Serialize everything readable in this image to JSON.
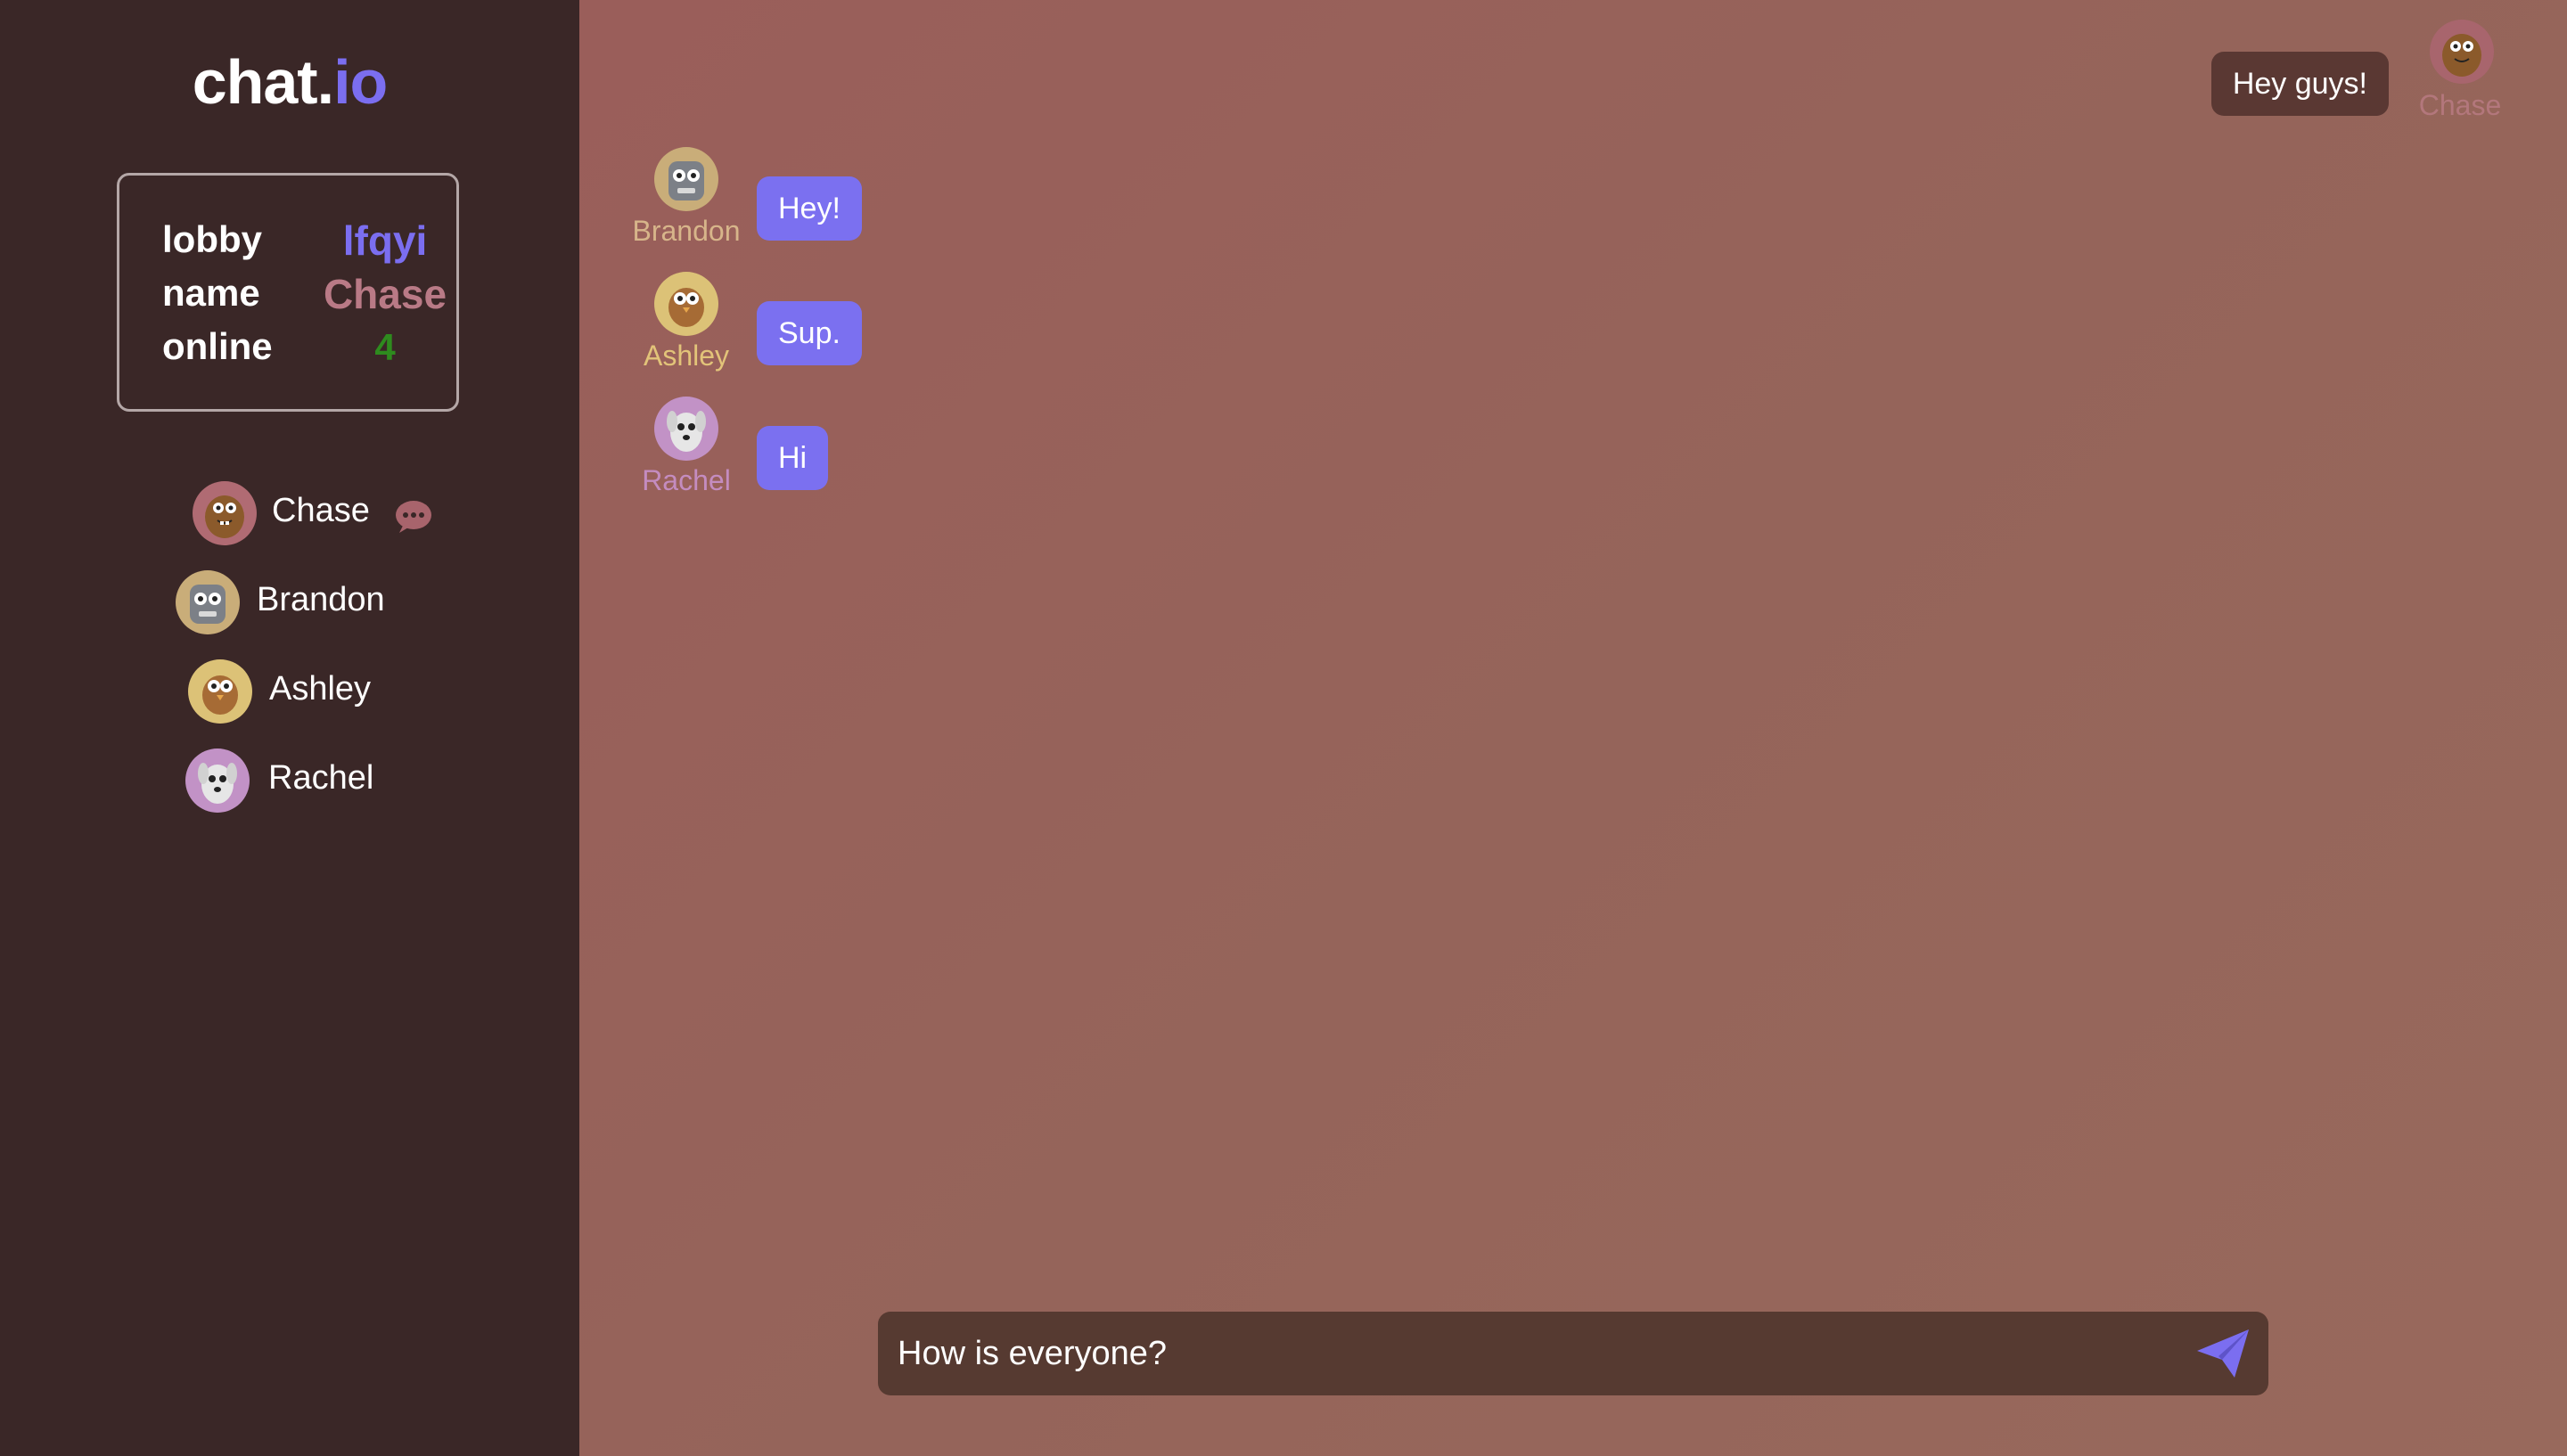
{
  "brand": {
    "name": "chat.",
    "accent": "io"
  },
  "info": {
    "lobby_label": "lobby",
    "lobby_value": "lfqyi",
    "name_label": "name",
    "name_value": "Chase",
    "online_label": "online",
    "online_value": "4"
  },
  "users": [
    {
      "name": "Chase",
      "avatar_color": "#b06b73",
      "typing": true
    },
    {
      "name": "Brandon",
      "avatar_color": "#c9ad79"
    },
    {
      "name": "Ashley",
      "avatar_color": "#dcc277"
    },
    {
      "name": "Rachel",
      "avatar_color": "#c292c6"
    }
  ],
  "messages": [
    {
      "sender": "Brandon",
      "text": "Hey!",
      "sender_color": "#d7b58a"
    },
    {
      "sender": "Ashley",
      "text": "Sup.",
      "sender_color": "#e2c379"
    },
    {
      "sender": "Rachel",
      "text": "Hi",
      "sender_color": "#c48cc0"
    }
  ],
  "own_message": {
    "sender": "Chase",
    "text": "Hey guys!"
  },
  "composer": {
    "value": "How is everyone?"
  },
  "colors": {
    "accent": "#7b6ef0",
    "sidebar_bg": "#3a2727",
    "bubble": "#7b70f0",
    "own_bubble": "#5a3833",
    "online": "#2e8b1e"
  }
}
